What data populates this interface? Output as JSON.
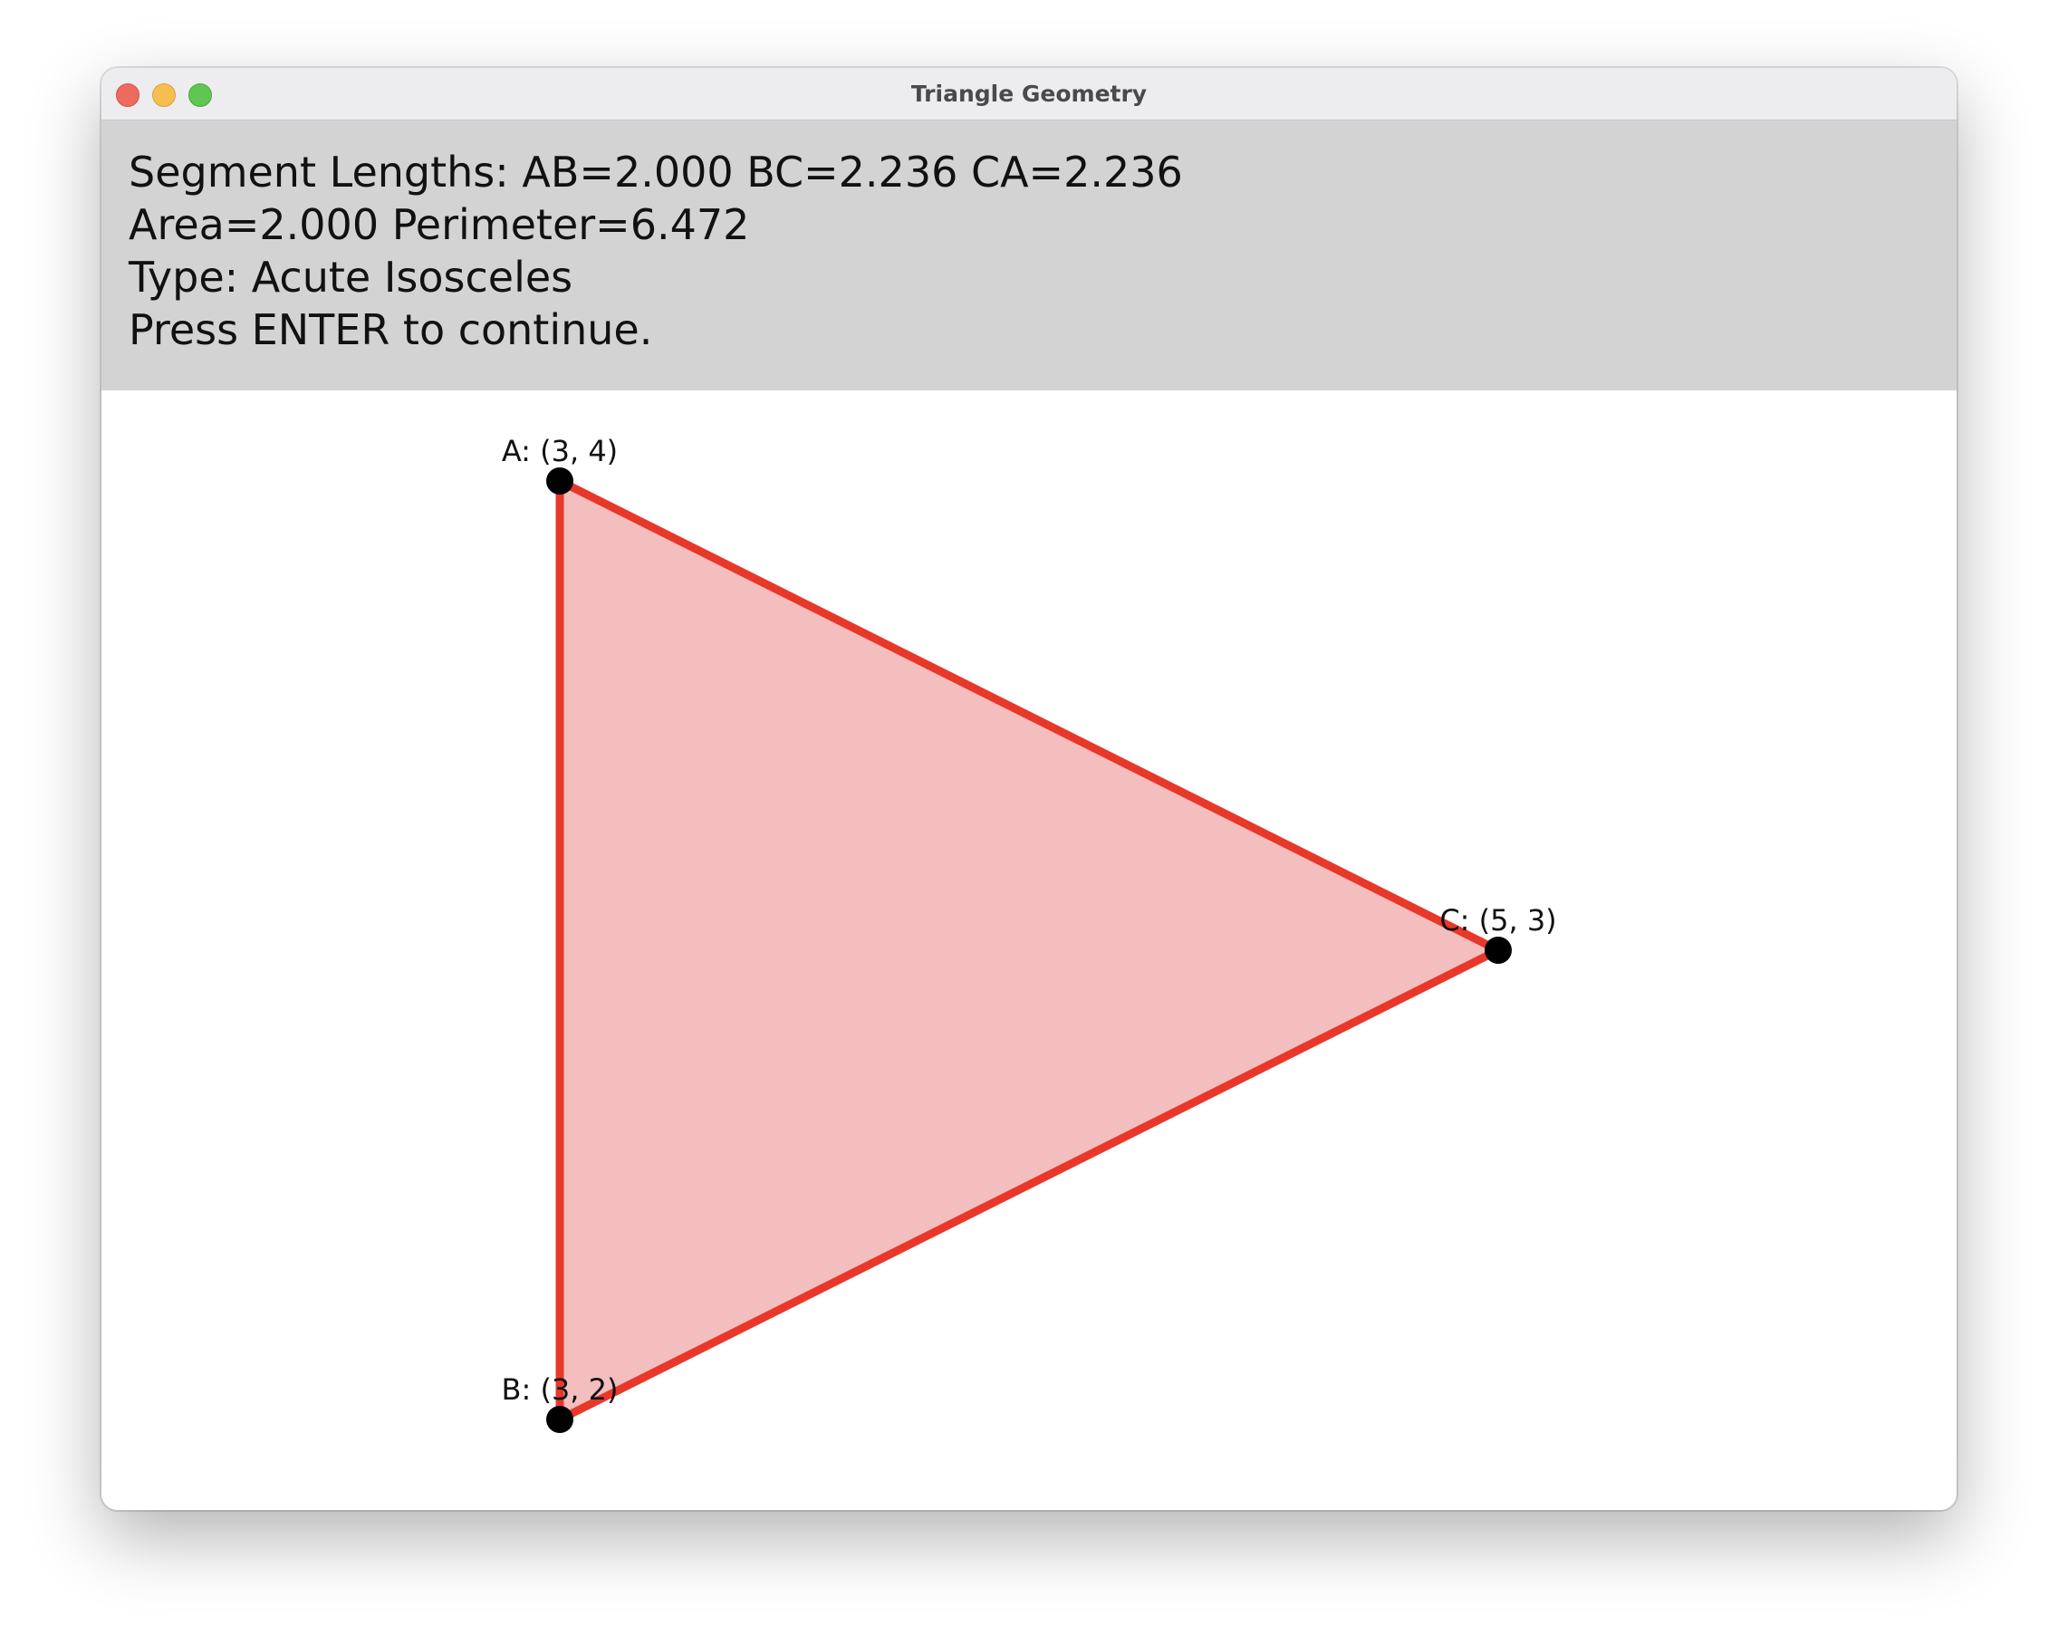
{
  "window": {
    "title": "Triangle Geometry"
  },
  "info": {
    "line1": "Segment Lengths: AB=2.000 BC=2.236 CA=2.236",
    "line2": "Area=2.000 Perimeter=6.472",
    "line3": "Type: Acute Isosceles",
    "line4": "Press ENTER to continue."
  },
  "triangle": {
    "fill_color": "#f4bebe",
    "stroke_color": "#e8382a",
    "vertex_color": "#000000",
    "vertices": [
      {
        "name": "A",
        "x": 3,
        "y": 4,
        "label": "A: (3, 4)"
      },
      {
        "name": "B",
        "x": 3,
        "y": 2,
        "label": "B: (3, 2)"
      },
      {
        "name": "C",
        "x": 5,
        "y": 3,
        "label": "C: (5, 3)"
      }
    ]
  }
}
